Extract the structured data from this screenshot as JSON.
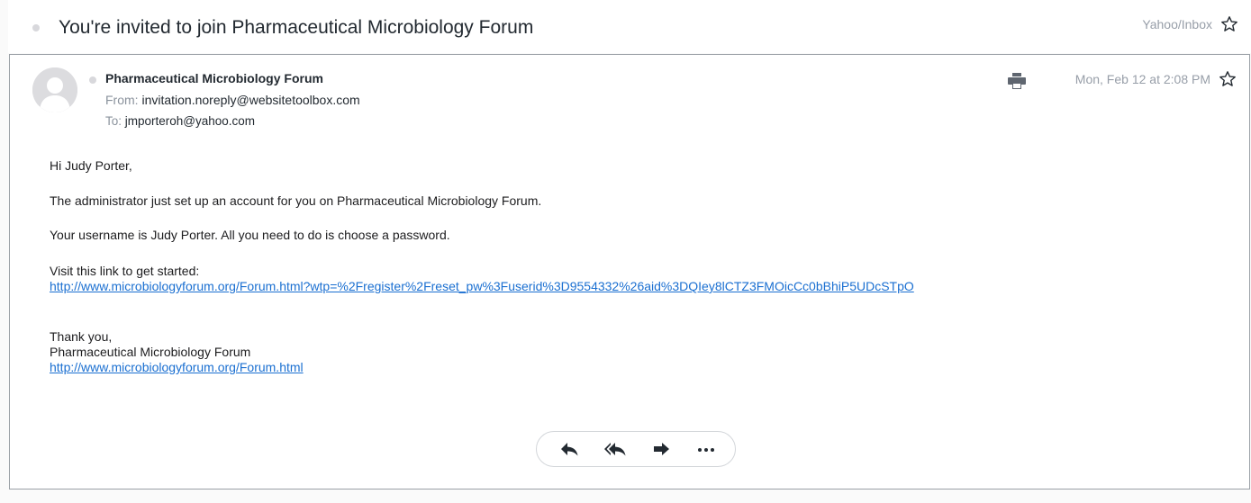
{
  "subject": {
    "title": "You're invited to join Pharmaceutical Microbiology Forum",
    "folder": "Yahoo/Inbox"
  },
  "message": {
    "sender_name": "Pharmaceutical Microbiology Forum",
    "from_label": "From:",
    "from_address": "invitation.noreply@websitetoolbox.com",
    "to_label": "To:",
    "to_address": "jmporteroh@yahoo.com",
    "date": "Mon, Feb 12 at 2:08 PM"
  },
  "body": {
    "greeting": "Hi Judy Porter,",
    "line1": "The administrator just set up an account for you on Pharmaceutical Microbiology Forum.",
    "line2": "Your username is Judy Porter. All you need to do is choose a password.",
    "visit": "Visit this link to get started:",
    "link1": "http://www.microbiologyforum.org/Forum.html?wtp=%2Fregister%2Freset_pw%3Fuserid%3D9554332%26aid%3DQIey8lCTZ3FMOicCc0bBhiP5UDcSTpO",
    "thanks": "Thank you,",
    "signature": "Pharmaceutical Microbiology Forum",
    "link2": "http://www.microbiologyforum.org/Forum.html"
  },
  "icons": {
    "subject_star": "star-outline-icon",
    "message_star": "star-outline-icon",
    "print": "print-icon",
    "reply": "reply-icon",
    "reply_all": "reply-all-icon",
    "forward": "forward-icon",
    "more": "more-icon",
    "avatar": "default-avatar-icon"
  },
  "colors": {
    "link": "#1a6fd1",
    "muted": "#979ea8",
    "icon": "#232a31",
    "border": "#9aa0a6"
  }
}
